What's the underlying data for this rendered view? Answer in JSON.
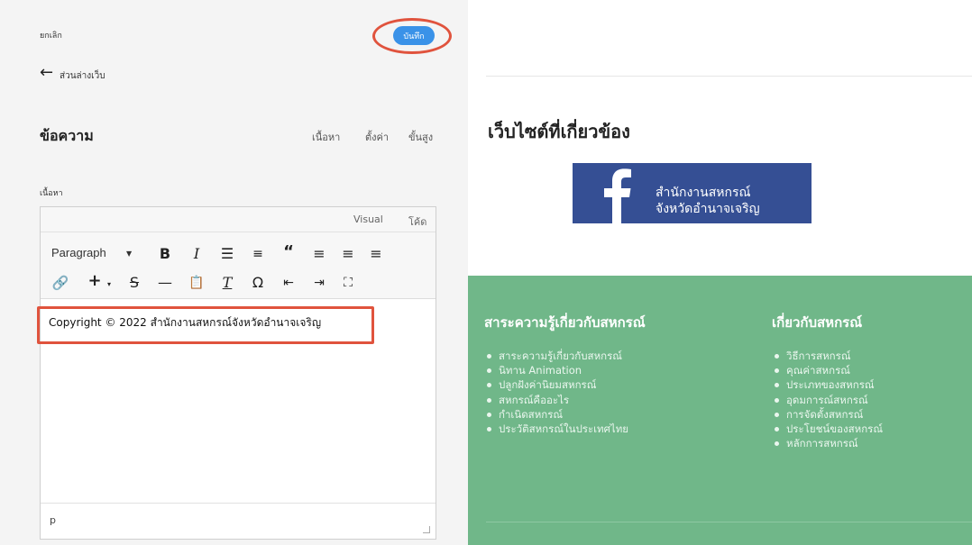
{
  "header": {
    "cancel_label": "ยกเลิก",
    "save_label": "บันทึก",
    "back_label": "ส่วนล่างเว็บ"
  },
  "block": {
    "title": "ข้อความ",
    "tabs": [
      "เนื้อหา",
      "ตั้งค่า",
      "ขั้นสูง"
    ],
    "field_label": "เนื้อหา"
  },
  "editor": {
    "modes": [
      "Visual",
      "โค้ด"
    ],
    "format_select": "Paragraph",
    "content": "Copyright © 2022 สำนักงานสหกรณ์จังหวัดอำนาจเจริญ",
    "status_path": "p"
  },
  "preview": {
    "heading": "เว็บไซต์ที่เกี่ยวข้อง",
    "banner_line1": "สำนักงานสหกรณ์",
    "banner_line2": "จังหวัดอำนาจเจริญ",
    "banner_color": "#354f94",
    "footer_color": "#70b789",
    "col1": {
      "title": "สาระความรู้เกี่ยวกับสหกรณ์",
      "items": [
        "สาระความรู้เกี่ยวกับสหกรณ์",
        "นิทาน Animation",
        "ปลูกฝังค่านิยมสหกรณ์",
        "สหกรณ์คืออะไร",
        "กำเนิดสหกรณ์",
        "ประวัติสหกรณ์ในประเทศไทย"
      ]
    },
    "col2": {
      "title": "เกี่ยวกับสหกรณ์",
      "items": [
        "วิธีการสหกรณ์",
        "คุณค่าสหกรณ์",
        "ประเภทของสหกรณ์",
        "อุดมการณ์สหกรณ์",
        "การจัดตั้งสหกรณ์",
        "ประโยชน์ของสหกรณ์",
        "หลักการสหกรณ์"
      ]
    }
  },
  "accent": {
    "save_button": "#3a92e8",
    "annotation": "#e0533d"
  }
}
